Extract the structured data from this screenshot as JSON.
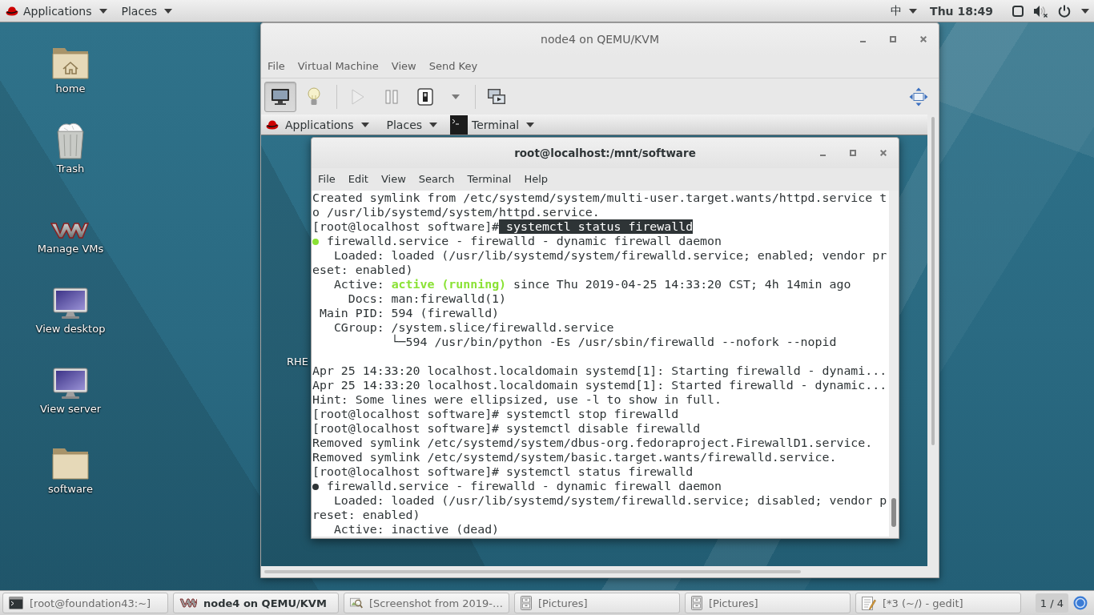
{
  "top_bar": {
    "menus": [
      {
        "label": "Applications"
      },
      {
        "label": "Places"
      }
    ],
    "input_method": "中",
    "clock": "Thu 18:49"
  },
  "desktop": {
    "icons": [
      {
        "kind": "home",
        "label": "home"
      },
      {
        "kind": "trash",
        "label": "Trash"
      },
      {
        "kind": "vm_manager",
        "label": "Manage VMs"
      },
      {
        "kind": "display",
        "label": "View desktop"
      },
      {
        "kind": "display",
        "label": "View server"
      },
      {
        "kind": "folder",
        "label": "software"
      }
    ]
  },
  "vm_window": {
    "title": "node4 on QEMU/KVM",
    "menu": [
      {
        "label": "File"
      },
      {
        "label": "Virtual Machine"
      },
      {
        "label": "View"
      },
      {
        "label": "Send Key"
      }
    ],
    "toolbar": [
      {
        "kind": "console",
        "selected": true,
        "disabled": false
      },
      {
        "kind": "details",
        "selected": false,
        "disabled": false
      },
      {
        "kind": "run",
        "selected": false,
        "disabled": true
      },
      {
        "kind": "pause",
        "selected": false,
        "disabled": false
      },
      {
        "kind": "shutdown",
        "selected": false,
        "disabled": false
      },
      {
        "kind": "shutdown_menu",
        "selected": false,
        "disabled": false
      },
      {
        "kind": "snapshots",
        "selected": false,
        "disabled": false
      },
      {
        "kind": "fullscreen",
        "selected": false,
        "disabled": false
      }
    ],
    "guest": {
      "top_bar": {
        "menus": [
          {
            "label": "Applications"
          },
          {
            "label": "Places"
          }
        ],
        "window_button": {
          "label": "Terminal"
        }
      },
      "desktop_label": "RHE",
      "terminal": {
        "title": "root@localhost:/mnt/software",
        "menu": [
          {
            "label": "File"
          },
          {
            "label": "Edit"
          },
          {
            "label": "View"
          },
          {
            "label": "Search"
          },
          {
            "label": "Terminal"
          },
          {
            "label": "Help"
          }
        ],
        "lines": [
          {
            "kind": "text",
            "segments": [
              {
                "kind": "plain",
                "text": "Created symlink from /etc/systemd/system/multi-user.target.wants/httpd.service t"
              }
            ]
          },
          {
            "kind": "text",
            "segments": [
              {
                "kind": "plain",
                "text": "o /usr/lib/systemd/system/httpd.service."
              }
            ]
          },
          {
            "kind": "text",
            "segments": [
              {
                "kind": "plain",
                "text": "[root@localhost software]#"
              },
              {
                "kind": "selection",
                "text": " systemctl status firewalld"
              }
            ]
          },
          {
            "kind": "text",
            "status_dot": {
              "color": "#8ae234"
            },
            "segments": [
              {
                "kind": "plain",
                "text": " firewalld.service - firewalld - dynamic firewall daemon"
              }
            ]
          },
          {
            "kind": "text",
            "segments": [
              {
                "kind": "plain",
                "text": "   Loaded: loaded (/usr/lib/systemd/system/firewalld.service; enabled; vendor pr"
              }
            ]
          },
          {
            "kind": "text",
            "segments": [
              {
                "kind": "plain",
                "text": "eset: enabled)"
              }
            ]
          },
          {
            "kind": "text",
            "segments": [
              {
                "kind": "plain",
                "text": "   Active: "
              },
              {
                "kind": "status",
                "text": "active (running)"
              },
              {
                "kind": "plain",
                "text": " since Thu 2019-04-25 14:33:20 CST; 4h 14min ago"
              }
            ]
          },
          {
            "kind": "text",
            "segments": [
              {
                "kind": "plain",
                "text": "     Docs: man:firewalld(1)"
              }
            ]
          },
          {
            "kind": "text",
            "segments": [
              {
                "kind": "plain",
                "text": " Main PID: 594 (firewalld)"
              }
            ]
          },
          {
            "kind": "text",
            "segments": [
              {
                "kind": "plain",
                "text": "   CGroup: /system.slice/firewalld.service"
              }
            ]
          },
          {
            "kind": "text",
            "segments": [
              {
                "kind": "plain",
                "text": "           └─594 /usr/bin/python -Es /usr/sbin/firewalld --nofork --nopid"
              }
            ]
          },
          {
            "kind": "blank"
          },
          {
            "kind": "text",
            "segments": [
              {
                "kind": "plain",
                "text": "Apr 25 14:33:20 localhost.localdomain systemd[1]: Starting firewalld - dynami..."
              }
            ]
          },
          {
            "kind": "text",
            "segments": [
              {
                "kind": "plain",
                "text": "Apr 25 14:33:20 localhost.localdomain systemd[1]: Started firewalld - dynamic..."
              }
            ]
          },
          {
            "kind": "text",
            "segments": [
              {
                "kind": "plain",
                "text": "Hint: Some lines were ellipsized, use -l to show in full."
              }
            ]
          },
          {
            "kind": "text",
            "segments": [
              {
                "kind": "plain",
                "text": "[root@localhost software]# systemctl stop firewalld"
              }
            ]
          },
          {
            "kind": "text",
            "segments": [
              {
                "kind": "plain",
                "text": "[root@localhost software]# systemctl disable firewalld"
              }
            ]
          },
          {
            "kind": "text",
            "segments": [
              {
                "kind": "plain",
                "text": "Removed symlink /etc/systemd/system/dbus-org.fedoraproject.FirewallD1.service."
              }
            ]
          },
          {
            "kind": "text",
            "segments": [
              {
                "kind": "plain",
                "text": "Removed symlink /etc/systemd/system/basic.target.wants/firewalld.service."
              }
            ]
          },
          {
            "kind": "text",
            "segments": [
              {
                "kind": "plain",
                "text": "[root@localhost software]# systemctl status firewalld"
              }
            ]
          },
          {
            "kind": "text",
            "status_dot": {
              "color": "#2e3436"
            },
            "segments": [
              {
                "kind": "plain",
                "text": " firewalld.service - firewalld - dynamic firewall daemon"
              }
            ]
          },
          {
            "kind": "text",
            "segments": [
              {
                "kind": "plain",
                "text": "   Loaded: loaded (/usr/lib/systemd/system/firewalld.service; disabled; vendor p"
              }
            ]
          },
          {
            "kind": "text",
            "segments": [
              {
                "kind": "plain",
                "text": "reset: enabled)"
              }
            ]
          },
          {
            "kind": "text",
            "segments": [
              {
                "kind": "plain",
                "text": "   Active: inactive (dead)"
              }
            ]
          }
        ]
      }
    }
  },
  "taskbar": {
    "windows": [
      {
        "kind": "terminal",
        "label": "[root@foundation43:~]",
        "selected": false
      },
      {
        "kind": "vm_manager",
        "label": "node4 on QEMU/KVM",
        "selected": true
      },
      {
        "kind": "image_viewer",
        "label": "[Screenshot from 2019-…",
        "selected": false
      },
      {
        "kind": "file_manager",
        "label": "[Pictures]",
        "selected": false
      },
      {
        "kind": "file_manager",
        "label": "[Pictures]",
        "selected": false
      },
      {
        "kind": "text_editor",
        "label": "[*3 (~/) - gedit]",
        "selected": false
      }
    ],
    "workspace": "1 / 4"
  }
}
